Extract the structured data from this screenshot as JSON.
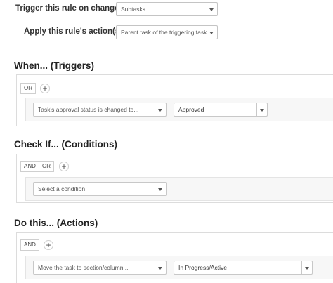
{
  "config": {
    "trigger_label": "Trigger this rule on changes to:",
    "trigger_value": "Subtasks",
    "apply_label": "Apply this rule's action(s) to:",
    "apply_value": "Parent task of the triggering task"
  },
  "when": {
    "title": "When... (Triggers)",
    "or_label": "OR",
    "add_label": "+",
    "trigger_field": "Task's approval status is changed to...",
    "value_field": "Approved"
  },
  "check": {
    "title": "Check If... (Conditions)",
    "and_label": "AND",
    "or_label": "OR",
    "add_label": "+",
    "condition_placeholder": "Select a condition"
  },
  "do": {
    "title": "Do this... (Actions)",
    "and_label": "AND",
    "add_label": "+",
    "action_field": "Move the task to section/column...",
    "value_field": "In Progress/Active"
  }
}
